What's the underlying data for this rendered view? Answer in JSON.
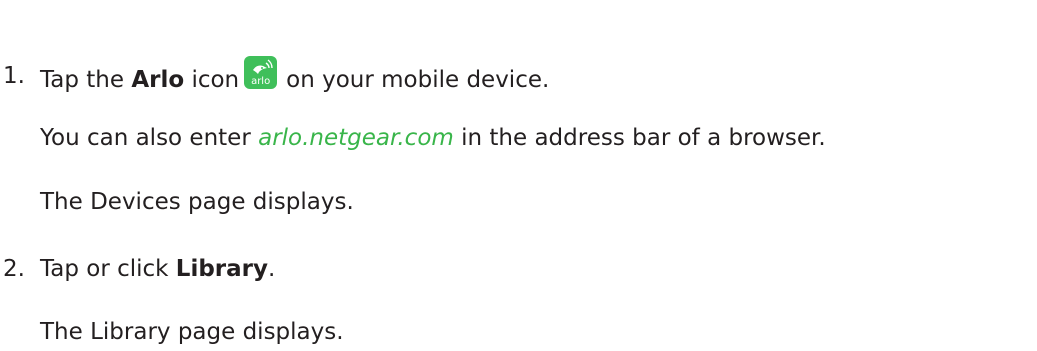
{
  "steps": [
    {
      "number": "1.",
      "text_before": "Tap the ",
      "bold": "Arlo",
      "text_middle": " icon",
      "icon": "arlo-app-icon",
      "icon_wordmark": "arlo",
      "text_after": "on your mobile device.",
      "details": [
        {
          "before": "You can also enter ",
          "link": "arlo.netgear.com",
          "after": " in the address bar of a browser."
        },
        {
          "text": "The Devices page displays."
        }
      ]
    },
    {
      "number": "2.",
      "text_before": "Tap or click ",
      "bold": "Library",
      "text_after": ".",
      "details": [
        {
          "text": "The Library page displays."
        }
      ]
    }
  ],
  "colors": {
    "text": "#231f20",
    "link": "#39b54a",
    "icon_bg": "#3fbf5a"
  }
}
